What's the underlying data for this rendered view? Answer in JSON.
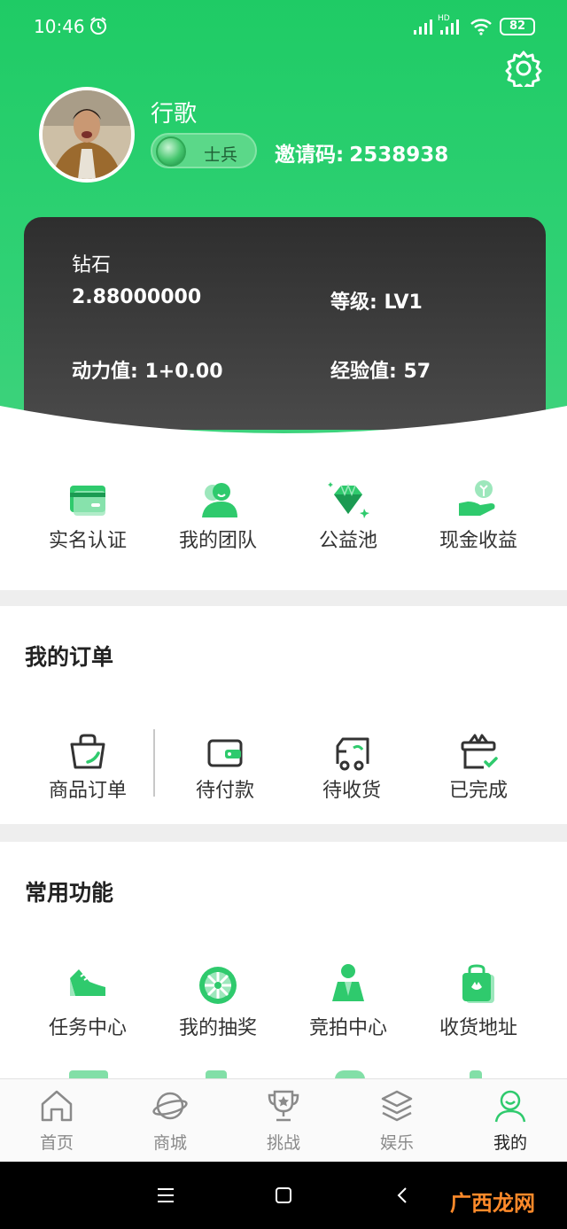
{
  "status_bar": {
    "time": "10:46",
    "network": "HD",
    "battery": "82"
  },
  "profile": {
    "name": "行歌",
    "rank": "士兵",
    "invite_label": "邀请码:",
    "invite_code": "2538938"
  },
  "card": {
    "diamond_label": "钻石",
    "diamond_value": "2.88000000",
    "level_label": "等级:",
    "level_value": "LV1",
    "power_label": "动力值:",
    "power_value": "1+0.00",
    "exp_label": "经验值:",
    "exp_value": "57"
  },
  "quick_links": [
    {
      "label": "实名认证",
      "icon": "id-card-icon"
    },
    {
      "label": "我的团队",
      "icon": "team-icon"
    },
    {
      "label": "公益池",
      "icon": "diamond-icon"
    },
    {
      "label": "现金收益",
      "icon": "cash-hand-icon"
    }
  ],
  "orders": {
    "title": "我的订单",
    "items": [
      {
        "label": "商品订单",
        "icon": "bag-icon"
      },
      {
        "label": "待付款",
        "icon": "wallet-icon"
      },
      {
        "label": "待收货",
        "icon": "truck-icon"
      },
      {
        "label": "已完成",
        "icon": "gift-check-icon"
      }
    ]
  },
  "common": {
    "title": "常用功能",
    "items": [
      {
        "label": "任务中心",
        "icon": "shoe-icon"
      },
      {
        "label": "我的抽奖",
        "icon": "lottery-wheel-icon"
      },
      {
        "label": "竞拍中心",
        "icon": "auction-person-icon"
      },
      {
        "label": "收货地址",
        "icon": "shopping-bag-icon"
      }
    ]
  },
  "bottom_nav": [
    {
      "label": "首页",
      "icon": "home-icon",
      "active": false
    },
    {
      "label": "商城",
      "icon": "planet-icon",
      "active": false
    },
    {
      "label": "挑战",
      "icon": "trophy-icon",
      "active": false
    },
    {
      "label": "娱乐",
      "icon": "layers-icon",
      "active": false
    },
    {
      "label": "我的",
      "icon": "person-icon",
      "active": true
    }
  ],
  "watermark": "广西龙网",
  "colors": {
    "accent": "#2fca6d",
    "card": "#3a3a3a",
    "inactive": "#8a8a8a"
  }
}
